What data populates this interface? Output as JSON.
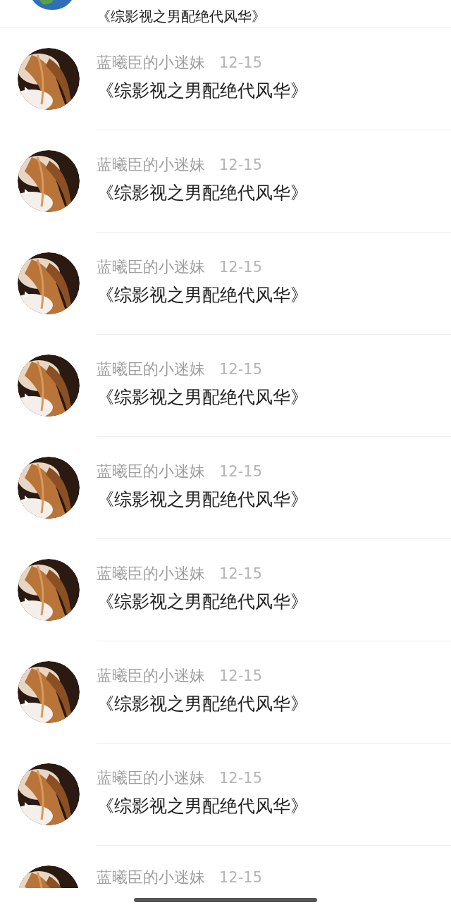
{
  "top_item": {
    "title": "《综影视之男配绝代风华》"
  },
  "comments": [
    {
      "author": "蓝曦臣的小迷妹",
      "date": "12-15",
      "title": "《综影视之男配绝代风华》"
    },
    {
      "author": "蓝曦臣的小迷妹",
      "date": "12-15",
      "title": "《综影视之男配绝代风华》"
    },
    {
      "author": "蓝曦臣的小迷妹",
      "date": "12-15",
      "title": "《综影视之男配绝代风华》"
    },
    {
      "author": "蓝曦臣的小迷妹",
      "date": "12-15",
      "title": "《综影视之男配绝代风华》"
    },
    {
      "author": "蓝曦臣的小迷妹",
      "date": "12-15",
      "title": "《综影视之男配绝代风华》"
    },
    {
      "author": "蓝曦臣的小迷妹",
      "date": "12-15",
      "title": "《综影视之男配绝代风华》"
    },
    {
      "author": "蓝曦臣的小迷妹",
      "date": "12-15",
      "title": "《综影视之男配绝代风华》"
    },
    {
      "author": "蓝曦臣的小迷妹",
      "date": "12-15",
      "title": "《综影视之男配绝代风华》"
    }
  ],
  "bottom_item": {
    "author": "蓝曦臣的小迷妹",
    "date": "12-15"
  }
}
